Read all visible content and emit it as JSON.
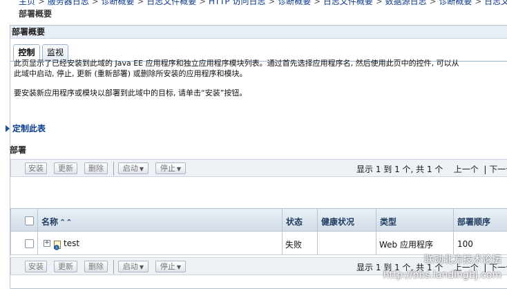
{
  "breadcrumb": [
    "主页",
    "服务器日志",
    "诊断概要",
    "日志文件概要",
    "HTTP 访问日志",
    "诊断概要",
    "日志文件概要",
    "数据源日志",
    "诊断概要",
    "日志文件概要"
  ],
  "breadcrumb_separator": ">",
  "page_title": "部署概要",
  "panel_title": "部署概要",
  "tabs": [
    {
      "label": "控制",
      "active": true
    },
    {
      "label": "监视",
      "active": false
    }
  ],
  "description": {
    "p1_line1": "此页显示了已经安装到此域的 Java EE 应用程序和独立应用程序模块列表。通过首先选择应用程序名, 然后使用此页中的控件, 可以从",
    "p1_line2": "此域中启动, 停止, 更新 (重新部署) 或删除所安装的应用程序和模块。",
    "p2": "要安装新应用程序或模块以部署到此域中的目标, 请单击“安装”按钮。"
  },
  "customize_label": "定制此表",
  "section_label": "部署",
  "toolbar": {
    "install": "安装",
    "update": "更新",
    "delete": "删除",
    "start": "启动",
    "stop": "停止",
    "pager_text": "显示 1 到 1 个, 共 1 个",
    "prev": "上一个",
    "next": "下一个"
  },
  "table": {
    "columns": [
      "名称",
      "状态",
      "健康状况",
      "类型",
      "部署顺序"
    ],
    "rows": [
      {
        "name": "test",
        "state": "失败",
        "health": "",
        "type": "Web 应用程序",
        "order": "100"
      }
    ]
  },
  "watermark": {
    "line1": "联动北方技术论坛",
    "line2": "http://bbs.landingbj.com"
  },
  "icons": {
    "expand": "plus-box-icon",
    "app": "web-app-icon",
    "sort": "sort-ascending-icon",
    "customize": "triangle-right-icon",
    "dropdown": "chevron-down-icon"
  },
  "colors": {
    "link": "#0b3b8c",
    "header_bg": "#d2dde8",
    "border": "#b5c3d3"
  }
}
